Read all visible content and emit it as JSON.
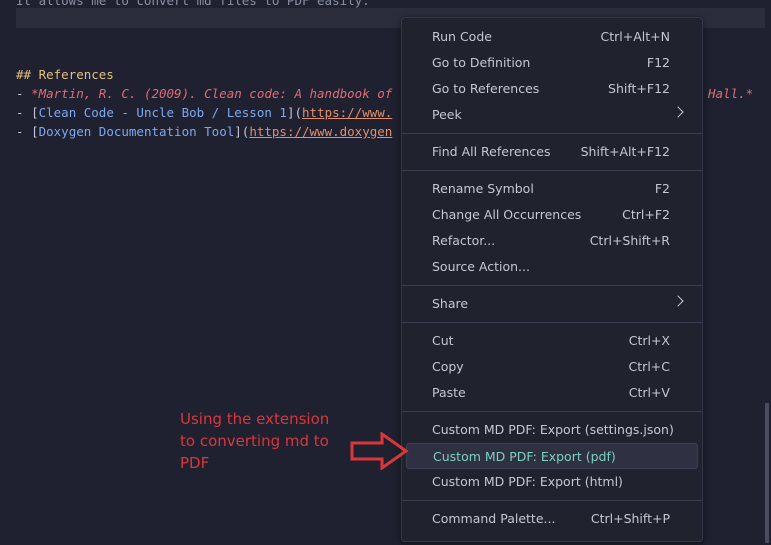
{
  "editor": {
    "top_line": "It allows me to convert md files to PDF easily.",
    "heading": "## References",
    "dash": "- ",
    "ref1": "*Martin, R. C. (2009). Clean code: A handbook of",
    "ref1_tail": "Hall.*",
    "link1_open": "[",
    "link1_text": "Clean Code - Uncle Bob / Lesson 1",
    "link1_mid": "](",
    "link1_url": "https://www.",
    "link2_open": "[",
    "link2_text": "Doxygen Documentation Tool",
    "link2_mid": "](",
    "link2_url": "https://www.doxygen"
  },
  "menu": {
    "groups": [
      [
        {
          "label": "Run Code",
          "shortcut": "Ctrl+Alt+N"
        },
        {
          "label": "Go to Definition",
          "shortcut": "F12"
        },
        {
          "label": "Go to References",
          "shortcut": "Shift+F12"
        },
        {
          "label": "Peek",
          "submenu": true
        }
      ],
      [
        {
          "label": "Find All References",
          "shortcut": "Shift+Alt+F12"
        }
      ],
      [
        {
          "label": "Rename Symbol",
          "shortcut": "F2"
        },
        {
          "label": "Change All Occurrences",
          "shortcut": "Ctrl+F2"
        },
        {
          "label": "Refactor...",
          "shortcut": "Ctrl+Shift+R"
        },
        {
          "label": "Source Action..."
        }
      ],
      [
        {
          "label": "Share",
          "submenu": true
        }
      ],
      [
        {
          "label": "Cut",
          "shortcut": "Ctrl+X"
        },
        {
          "label": "Copy",
          "shortcut": "Ctrl+C"
        },
        {
          "label": "Paste",
          "shortcut": "Ctrl+V"
        }
      ],
      [
        {
          "label": "Custom MD PDF: Export (settings.json)"
        },
        {
          "label": "Custom MD PDF: Export (pdf)",
          "active": true
        },
        {
          "label": "Custom MD PDF: Export (html)"
        }
      ],
      [
        {
          "label": "Command Palette...",
          "shortcut": "Ctrl+Shift+P"
        }
      ]
    ]
  },
  "annotation": {
    "text": "Using the extension to converting md to PDF",
    "color": "#d9373a"
  },
  "colors": {
    "active_label": "#7bd1c1",
    "heading": "#e5c07b",
    "link_url": "#e08f6d",
    "italic_ref": "#e06c75"
  }
}
